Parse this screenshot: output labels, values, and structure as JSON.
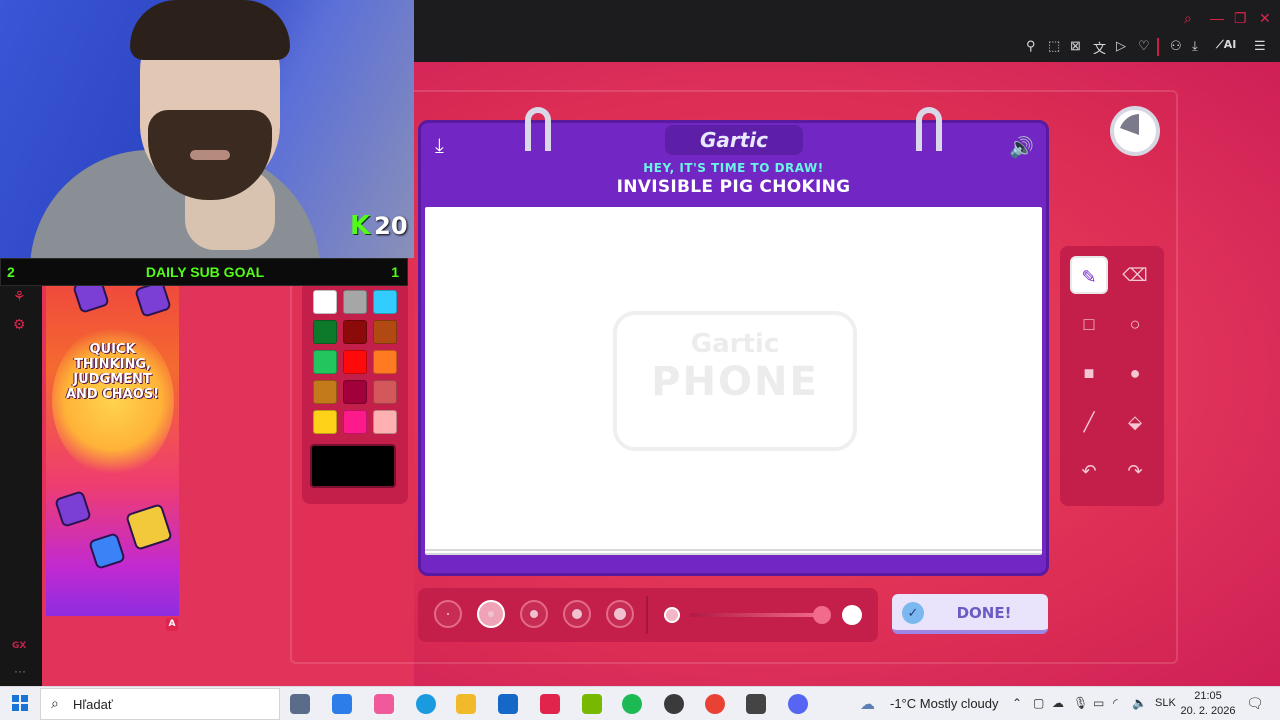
{
  "browser": {
    "window_controls": [
      {
        "icon": "search-icon",
        "glyph": "⌕"
      },
      {
        "icon": "minimize-icon",
        "glyph": "—"
      },
      {
        "icon": "restore-icon",
        "glyph": "❐"
      },
      {
        "icon": "close-icon",
        "glyph": "✕"
      }
    ],
    "toolbar": [
      {
        "icon": "pin-icon",
        "glyph": "📌"
      },
      {
        "icon": "screenshot-icon",
        "glyph": "⬚"
      },
      {
        "icon": "adblock-icon",
        "glyph": "⊠"
      },
      {
        "icon": "translate-icon",
        "glyph": "文"
      },
      {
        "icon": "player-icon",
        "glyph": "▷"
      },
      {
        "icon": "heart-icon",
        "glyph": "♡"
      },
      {
        "icon": "wallet-icon",
        "glyph": "⚇"
      },
      {
        "icon": "download-icon",
        "glyph": "⤓"
      },
      {
        "icon": "ai-icon",
        "label": "AI"
      },
      {
        "icon": "menu-icon",
        "glyph": "☰"
      }
    ]
  },
  "stream": {
    "kick_viewers": "20",
    "kick_logo": "K",
    "sub_goal": {
      "left": "2",
      "label": "DAILY SUB GOAL",
      "right": "1"
    },
    "side_rail_label": "GX",
    "side_rail_more": "···",
    "ad_tagline": "QUICK THINKING, JUDGMENT AND CHAOS!",
    "ad_marker": "A"
  },
  "game": {
    "logo": "Gartic",
    "prompt_header": "HEY, IT'S TIME TO DRAW!",
    "prompt": "INVISIBLE PIG CHOKING",
    "watermark_top": "Gartic",
    "watermark_bottom": "PHONE",
    "done_label": "DONE!",
    "palette": [
      "#ffffff",
      "#a6a6a6",
      "#33ccff",
      "#0c7a2a",
      "#8c0a0a",
      "#b04a12",
      "#22c55e",
      "#ff0a0a",
      "#ff7a20",
      "#c27a1a",
      "#a2003a",
      "#d4575c",
      "#ffd21a",
      "#ff1a8c",
      "#ffb0b0"
    ],
    "current_color": "#000000",
    "tools": [
      {
        "name": "pen-tool",
        "glyph": "✎",
        "active": true
      },
      {
        "name": "eraser-tool",
        "glyph": "⌫",
        "active": false
      },
      {
        "name": "rectangle-outline-tool",
        "glyph": "□",
        "active": false
      },
      {
        "name": "ellipse-outline-tool",
        "glyph": "○",
        "active": false
      },
      {
        "name": "rectangle-fill-tool",
        "glyph": "■",
        "active": false
      },
      {
        "name": "ellipse-fill-tool",
        "glyph": "●",
        "active": false
      },
      {
        "name": "line-tool",
        "glyph": "╱",
        "active": false
      },
      {
        "name": "fill-bucket-tool",
        "glyph": "⬙",
        "active": false
      },
      {
        "name": "undo-tool",
        "glyph": "↶",
        "active": false
      },
      {
        "name": "redo-tool",
        "glyph": "↷",
        "active": false
      }
    ],
    "brush_sizes": [
      2,
      6,
      8,
      10,
      12
    ],
    "selected_brush_index": 1,
    "accent_purple": "#7226c4",
    "accent_red": "#c41f4a"
  },
  "taskbar": {
    "search_placeholder": "Hľadať",
    "weather": "-1°C  Mostly cloudy",
    "lang": "SLK",
    "time": "21:05",
    "date": "20. 2. 2026",
    "apps": [
      {
        "name": "task-view-icon",
        "color": "#5b6b8a"
      },
      {
        "name": "store-icon",
        "color": "#2b7de9"
      },
      {
        "name": "copilot-icon",
        "color": "#f05a9a"
      },
      {
        "name": "edge-icon",
        "color": "#1a9be0"
      },
      {
        "name": "file-explorer-icon",
        "color": "#f2b92b"
      },
      {
        "name": "outlook-icon",
        "color": "#1668c8"
      },
      {
        "name": "opera-gx-icon",
        "color": "#e0244c"
      },
      {
        "name": "nvidia-icon",
        "color": "#76b900"
      },
      {
        "name": "spotify-icon",
        "color": "#1db954"
      },
      {
        "name": "obs-icon",
        "color": "#3a3a3a"
      },
      {
        "name": "chrome-icon",
        "color": "#e94235"
      },
      {
        "name": "settings-icon",
        "color": "#444444"
      },
      {
        "name": "discord-icon",
        "color": "#5865f2"
      }
    ]
  }
}
